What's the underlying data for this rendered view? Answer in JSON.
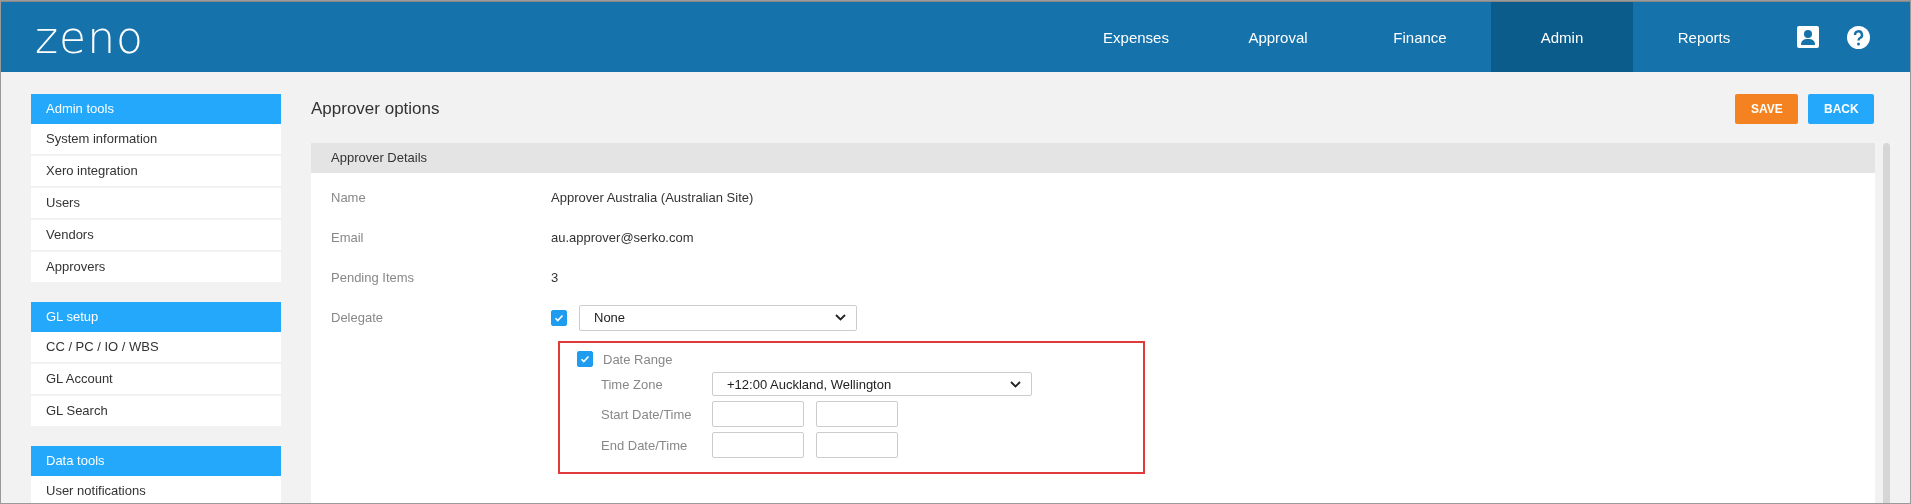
{
  "logo": "zeno",
  "nav": [
    {
      "label": "Expenses",
      "selected": false
    },
    {
      "label": "Approval",
      "selected": false
    },
    {
      "label": "Finance",
      "selected": false
    },
    {
      "label": "Admin",
      "selected": true
    },
    {
      "label": "Reports",
      "selected": false
    }
  ],
  "sidebar": [
    {
      "title": "Admin tools",
      "items": [
        "System information",
        "Xero integration",
        "Users",
        "Vendors",
        "Approvers"
      ]
    },
    {
      "title": "GL setup",
      "items": [
        "CC / PC / IO / WBS",
        "GL Account",
        "GL Search"
      ]
    },
    {
      "title": "Data tools",
      "items": [
        "User notifications"
      ]
    }
  ],
  "page_title": "Approver options",
  "buttons": [
    {
      "label": "SAVE",
      "kind": "primary"
    },
    {
      "label": "BACK",
      "kind": "secondary"
    }
  ],
  "panel": {
    "title": "Approver Details",
    "fields": [
      {
        "label": "Name",
        "value": "Approver Australia (Australian Site)"
      },
      {
        "label": "Email",
        "value": "au.approver@serko.com"
      },
      {
        "label": "Pending Items",
        "value": "3"
      }
    ],
    "delegate": {
      "label": "Delegate",
      "checked": true,
      "value": "None"
    },
    "date_range": {
      "label": "Date Range",
      "checked": true,
      "time_zone_label": "Time Zone",
      "time_zone": "+12:00 Auckland, Wellington",
      "start_label": "Start Date/Time",
      "end_label": "End Date/Time"
    }
  }
}
